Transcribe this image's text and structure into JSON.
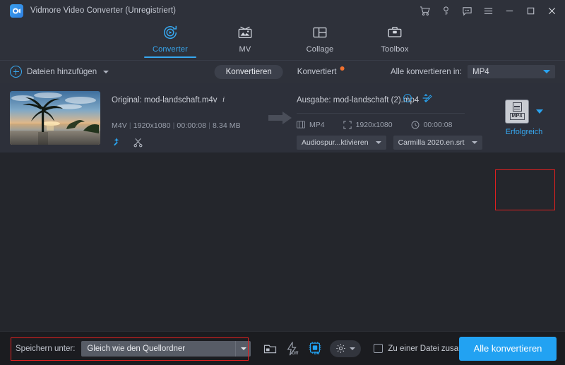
{
  "titlebar": {
    "app_name": "Vidmore Video Converter (Unregistriert)",
    "logo_icon": "vidmore-logo-icon",
    "controls": [
      {
        "name": "cart-icon",
        "label": "Warenkorb"
      },
      {
        "name": "key-icon",
        "label": "Registrieren"
      },
      {
        "name": "feedback-icon",
        "label": "Feedback"
      },
      {
        "name": "menu-icon",
        "label": "Menü"
      },
      {
        "name": "minimize-icon",
        "label": "Minimieren"
      },
      {
        "name": "maximize-icon",
        "label": "Maximieren"
      },
      {
        "name": "close-icon",
        "label": "Schließen"
      }
    ]
  },
  "tabs": [
    {
      "label": "Converter",
      "icon": "converter-icon",
      "active": true
    },
    {
      "label": "MV",
      "icon": "mv-icon",
      "active": false
    },
    {
      "label": "Collage",
      "icon": "collage-icon",
      "active": false
    },
    {
      "label": "Toolbox",
      "icon": "toolbox-icon",
      "active": false
    }
  ],
  "toolbar": {
    "add_files_label": "Dateien hinzufügen",
    "segments": [
      {
        "label": "Konvertieren",
        "active": true,
        "badge": false
      },
      {
        "label": "Konvertiert",
        "active": false,
        "badge": true
      }
    ],
    "convert_all_label": "Alle konvertieren in:",
    "convert_all_value": "MP4"
  },
  "file_row": {
    "thumbnail_alt": "Strand Sonnenuntergang mit Palme",
    "source": {
      "title": "Original: mod-landschaft.m4v",
      "info_icon": "info-italic-icon",
      "format": "M4V",
      "resolution": "1920x1080",
      "duration": "00:00:08",
      "size": "8.34 MB",
      "edit_icon": "magic-wand-icon",
      "trim_icon": "scissors-icon"
    },
    "output": {
      "title": "Ausgabe: mod-landschaft (2).mp4",
      "edit_icon": "pencil-icon",
      "info_icon": "info-circle-icon",
      "compress_icon": "compress-arrows-icon",
      "format": "MP4",
      "resolution": "1920x1080",
      "duration": "00:00:08",
      "audio_track": "Audiospur...ktivieren",
      "subtitle_track": "Carmilla 2020.en.srt"
    },
    "status": {
      "format_badge": "MP4",
      "text": "Erfolgreich"
    }
  },
  "bottombar": {
    "save_to_label": "Speichern unter:",
    "save_to_value": "Gleich wie den Quellordner",
    "icons": [
      {
        "name": "open-folder-icon",
        "label": "Ordner öffnen"
      },
      {
        "name": "hardware-accel-off-icon",
        "label": "Off"
      },
      {
        "name": "gpu-accel-on-icon",
        "label": "ON"
      },
      {
        "name": "settings-gear-icon",
        "label": "Einstellungen"
      }
    ],
    "merge_label": "Zu einer Datei zusammenfügen",
    "merge_checked": false,
    "convert_button": "Alle konvertieren"
  },
  "colors": {
    "accent": "#37a8f0",
    "highlight": "#e02020",
    "badge": "#f2712e",
    "titlebar_bg": "#2e313a",
    "list_bg": "#24262c",
    "row_bg": "#2d303a",
    "bottom_bg": "#1b1c20"
  }
}
